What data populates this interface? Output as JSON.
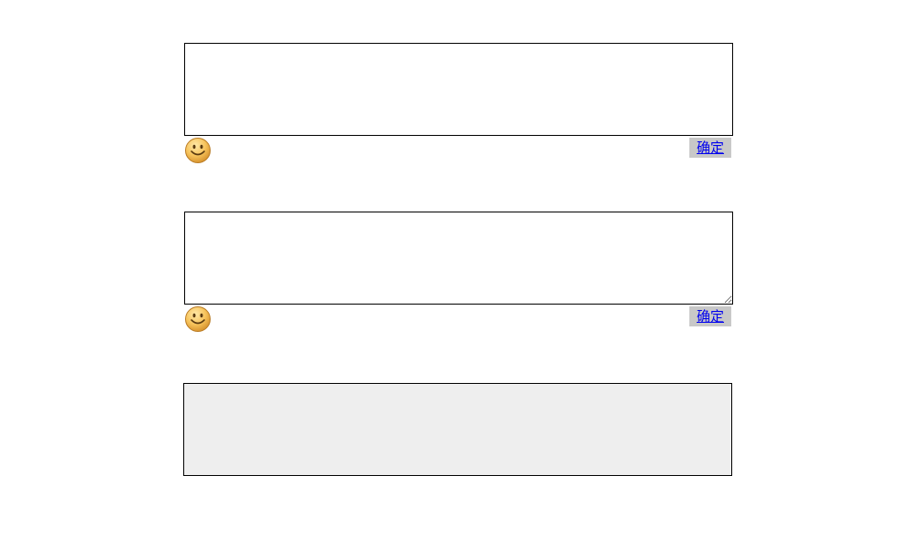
{
  "editors": [
    {
      "value": "",
      "placeholder": "",
      "emoji_icon": "smiley-face-icon",
      "confirm_label": "确定"
    },
    {
      "value": "",
      "placeholder": "",
      "emoji_icon": "smiley-face-icon",
      "confirm_label": "确定"
    }
  ],
  "preview": {
    "text": ""
  },
  "colors": {
    "preview_background": "#eeeeee",
    "confirm_background": "#c8c8c8",
    "link": "#0000ee",
    "border": "#000000"
  }
}
